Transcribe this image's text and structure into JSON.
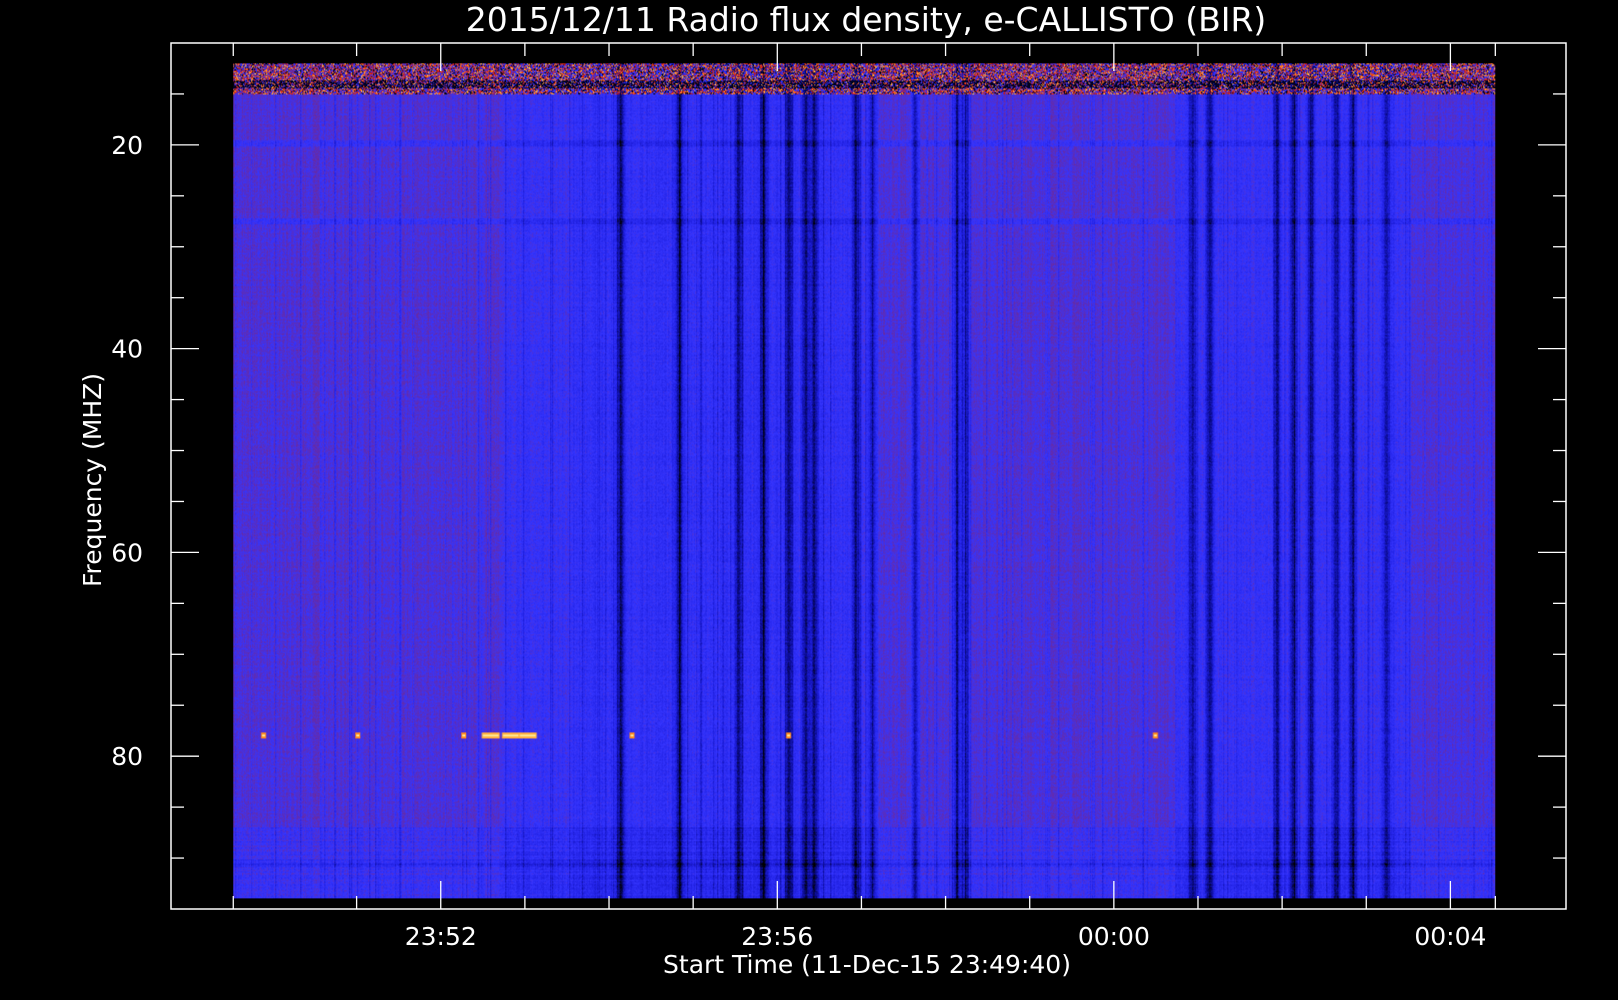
{
  "chart_data": {
    "type": "heatmap",
    "title": "2015/12/11  Radio flux density, e-CALLISTO (BIR)",
    "xlabel": "Start Time (11-Dec-15 23:49:40)",
    "ylabel": "Frequency (MHZ)",
    "x_axis": {
      "unit": "minutes after 23:49:40",
      "range": [
        -3.7,
        79.2
      ],
      "data_extent": [
        0.0,
        75.0
      ],
      "major_ticks": [
        {
          "value": 12.33,
          "label": "23:52"
        },
        {
          "value": 32.33,
          "label": "23:56"
        },
        {
          "value": 52.33,
          "label": "00:00"
        },
        {
          "value": 72.33,
          "label": "00:04"
        }
      ],
      "minor_ticks": [
        0.0,
        7.33,
        17.33,
        22.33,
        27.33,
        37.33,
        42.33,
        47.33,
        57.33,
        62.33,
        67.33,
        75.0
      ]
    },
    "y_axis": {
      "reversed": true,
      "range": [
        10.0,
        95.0
      ],
      "data_extent": [
        12.0,
        94.0
      ],
      "major_ticks": [
        {
          "value": 20,
          "label": "20"
        },
        {
          "value": 40,
          "label": "40"
        },
        {
          "value": 60,
          "label": "60"
        },
        {
          "value": 80,
          "label": "80"
        }
      ],
      "minor_ticks": [
        15,
        25,
        30,
        35,
        45,
        50,
        55,
        65,
        70,
        75,
        85,
        90
      ]
    },
    "colormap": [
      "#000000",
      "#0a0a8c",
      "#1f1fe0",
      "#3535ff",
      "#6a2aa0",
      "#7a2a6e",
      "#c8141a",
      "#ff5010",
      "#ff9a30",
      "#ffe070"
    ],
    "dark_columns_minutes": [
      23.0,
      26.5,
      30.0,
      31.5,
      33.0,
      34.0,
      34.5,
      37.0,
      38.0,
      40.5,
      43.0,
      43.5,
      57.0,
      58.0,
      62.0,
      63.0,
      64.0,
      65.5,
      66.5,
      68.5
    ],
    "high_flux_band_mhz": [
      12.0,
      15.0
    ],
    "emission_events": [
      {
        "time_min": 15.3,
        "freq_mhz": 78.0,
        "level": "high"
      },
      {
        "time_min": 16.5,
        "freq_mhz": 78.0,
        "level": "high"
      },
      {
        "time_min": 17.5,
        "freq_mhz": 78.0,
        "level": "high"
      },
      {
        "time_min": 13.7,
        "freq_mhz": 78.0,
        "level": "medium"
      },
      {
        "time_min": 1.8,
        "freq_mhz": 78.0,
        "level": "medium"
      },
      {
        "time_min": 7.4,
        "freq_mhz": 78.0,
        "level": "medium"
      },
      {
        "time_min": 23.7,
        "freq_mhz": 78.0,
        "level": "medium"
      },
      {
        "time_min": 33.0,
        "freq_mhz": 78.0,
        "level": "medium"
      },
      {
        "time_min": 54.8,
        "freq_mhz": 78.0,
        "level": "medium"
      }
    ]
  }
}
